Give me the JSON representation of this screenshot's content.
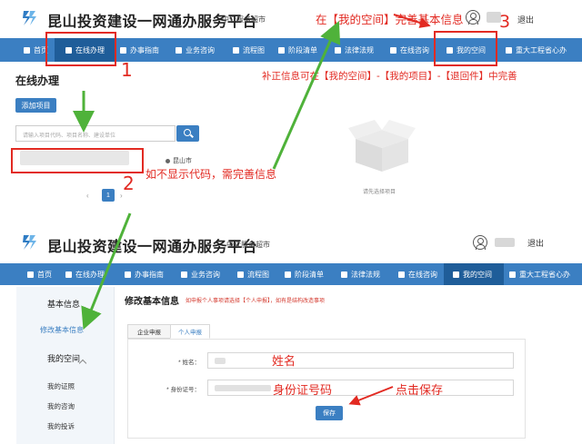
{
  "portal": {
    "title": "昆山投资建设一网通办服务平台",
    "subtitle_top": "中介服务超市",
    "subtitle_bottom": "中介服务超市",
    "logout": "退出"
  },
  "nav": {
    "top": [
      "首页",
      "在线办理",
      "办事指南",
      "业务咨询",
      "流程图",
      "阶段清单",
      "法律法规",
      "在线咨询",
      "我的空间",
      "重大工程省心办"
    ],
    "bottom": [
      "首页",
      "在线办理",
      "办事指南",
      "业务咨询",
      "流程图",
      "阶段清单",
      "法律法规",
      "在线咨询",
      "我的空间",
      "重大工程省心办"
    ]
  },
  "online": {
    "heading": "在线办理",
    "add_button": "添加项目",
    "search_placeholder": "请输入项目代码、项目名称、建设单位",
    "location": "昆山市",
    "pager_prev": "‹",
    "pager_current": "1",
    "pager_next": "›",
    "empty_label": "请先选择项目"
  },
  "space": {
    "sidebar": {
      "basic_info": "基本信息",
      "edit_info": "修改基本信息",
      "my_space": "我的空间",
      "my_certs": "我的证照",
      "my_consults": "我的咨询",
      "my_complaints": "我的投诉"
    },
    "form": {
      "title": "修改基本信息",
      "hint": "如申报个人事项请选择【个人申报】，如有是结构改造事项",
      "tab_enterprise": "企业申报",
      "tab_personal": "个人申报",
      "name_label": "* 姓名：",
      "id_label": "* 身份证号：",
      "save_button": "保存"
    }
  },
  "annotations": {
    "step_1": "1",
    "step_2": "2",
    "step_3": "3",
    "goto_space": "在【我的空间】完善基本信息",
    "supplement": "补正信息可在【我的空间】-【我的项目】-【退回件】中完善",
    "no_code": "如不显示代码，需完善信息",
    "name": "姓名",
    "id_number": "身份证号码",
    "click_save": "点击保存"
  },
  "colors": {
    "nav_blue": "#3b7fc2",
    "nav_active": "#1f5d99",
    "annotation_red": "#e22a22",
    "arrow_green": "#4fb23a"
  }
}
